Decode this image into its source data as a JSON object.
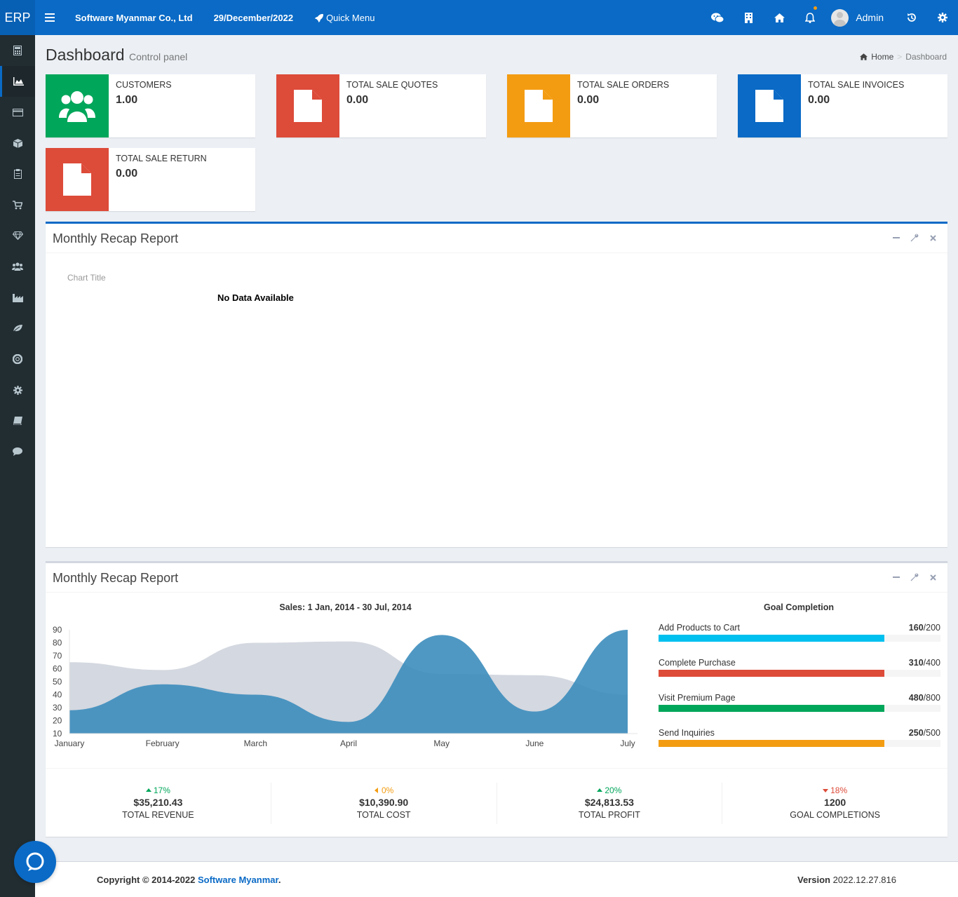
{
  "topbar": {
    "logo": "ERP",
    "company": "Software Myanmar Co., Ltd",
    "date": "29/December/2022",
    "quick_menu": "Quick Menu",
    "user": "Admin",
    "icons": [
      "wechat-icon",
      "building-icon",
      "home-icon",
      "bell-icon",
      "history-icon",
      "gear-icon"
    ]
  },
  "sidebar": {
    "icons": [
      "calculator-icon",
      "area-chart-icon",
      "credit-card-icon",
      "cube-icon",
      "clipboard-icon",
      "cart-icon",
      "diamond-icon",
      "users-icon",
      "industry-icon",
      "leaf-icon",
      "life-ring-icon",
      "gear-icon",
      "book-icon",
      "comment-icon"
    ],
    "active_index": 1
  },
  "header": {
    "title": "Dashboard",
    "subtitle": "Control panel",
    "breadcrumb_home": "Home",
    "breadcrumb_current": "Dashboard"
  },
  "info_boxes": [
    {
      "label": "CUSTOMERS",
      "value": "1.00",
      "color": "#00a65a",
      "icon": "users-icon"
    },
    {
      "label": "TOTAL SALE QUOTES",
      "value": "0.00",
      "color": "#dd4b39",
      "icon": "file-icon"
    },
    {
      "label": "TOTAL SALE ORDERS",
      "value": "0.00",
      "color": "#f39c12",
      "icon": "file-icon"
    },
    {
      "label": "TOTAL SALE INVOICES",
      "value": "0.00",
      "color": "#0a6ac6",
      "icon": "file-icon"
    },
    {
      "label": "TOTAL SALE RETURN",
      "value": "0.00",
      "color": "#dd4b39",
      "icon": "file-icon"
    }
  ],
  "panel1": {
    "title": "Monthly Recap Report",
    "chart_title": "Chart Title",
    "no_data": "No Data Available"
  },
  "panel2": {
    "title": "Monthly Recap Report",
    "sales_title": "Sales: 1 Jan, 2014 - 30 Jul, 2014",
    "goal_title": "Goal Completion",
    "goals": [
      {
        "label": "Add Products to Cart",
        "value": "160",
        "total": "/200",
        "fraction": 0.8,
        "color": "#00c0ef"
      },
      {
        "label": "Complete Purchase",
        "value": "310",
        "total": "/400",
        "fraction": 0.8,
        "color": "#dd4b39"
      },
      {
        "label": "Visit Premium Page",
        "value": "480",
        "total": "/800",
        "fraction": 0.8,
        "color": "#00a65a"
      },
      {
        "label": "Send Inquiries",
        "value": "250",
        "total": "/500",
        "fraction": 0.8,
        "color": "#f39c12"
      }
    ],
    "stats": [
      {
        "pct": "17%",
        "dir": "up",
        "color": "#00a65a",
        "value": "$35,210.43",
        "label": "TOTAL REVENUE"
      },
      {
        "pct": "0%",
        "dir": "left",
        "color": "#f39c12",
        "value": "$10,390.90",
        "label": "TOTAL COST"
      },
      {
        "pct": "20%",
        "dir": "up",
        "color": "#00a65a",
        "value": "$24,813.53",
        "label": "TOTAL PROFIT"
      },
      {
        "pct": "18%",
        "dir": "down",
        "color": "#dd4b39",
        "value": "1200",
        "label": "GOAL COMPLETIONS"
      }
    ]
  },
  "chart_data": {
    "type": "area",
    "categories": [
      "January",
      "February",
      "March",
      "April",
      "May",
      "June",
      "July"
    ],
    "yticks": [
      "90",
      "80",
      "70",
      "60",
      "50",
      "40",
      "30",
      "20",
      "10"
    ],
    "ylim": [
      10,
      90
    ],
    "series": [
      {
        "values": [
          65,
          59,
          80,
          81,
          56,
          55,
          40
        ],
        "color": "#d2d6de"
      },
      {
        "values": [
          28,
          48,
          40,
          19,
          86,
          27,
          90
        ],
        "color": "#3c8dbc"
      }
    ],
    "grid": false,
    "title": "Sales: 1 Jan, 2014 - 30 Jul, 2014"
  },
  "footer": {
    "copyright": "Copyright © 2014-2022 ",
    "company_link": "Software Myanmar",
    "period": ".",
    "version_label": "Version",
    "version": "2022.12.27.816"
  }
}
